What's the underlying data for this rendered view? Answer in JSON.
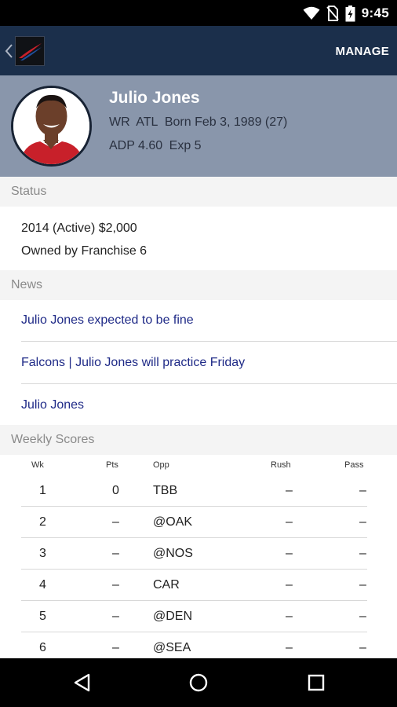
{
  "status_bar": {
    "time": "9:45"
  },
  "app_bar": {
    "manage_label": "MANAGE"
  },
  "player": {
    "name": "Julio Jones",
    "position": "WR",
    "team": "ATL",
    "born": "Born Feb 3, 1989 (27)",
    "adp": "ADP 4.60",
    "exp": "Exp 5"
  },
  "sections": {
    "status": "Status",
    "news": "News",
    "weekly_scores": "Weekly Scores"
  },
  "status_info": {
    "contract": "2014 (Active) $2,000",
    "owner": "Owned by Franchise 6"
  },
  "news": [
    "Julio Jones expected to be fine",
    "Falcons | Julio Jones will practice Friday",
    "Julio Jones"
  ],
  "scores": {
    "columns": {
      "wk": "Wk",
      "pts": "Pts",
      "opp": "Opp",
      "rush": "Rush",
      "pass": "Pass"
    },
    "rows": [
      {
        "wk": "1",
        "pts": "0",
        "opp": "TBB",
        "rush": "–",
        "pass": "–"
      },
      {
        "wk": "2",
        "pts": "–",
        "opp": "@OAK",
        "rush": "–",
        "pass": "–"
      },
      {
        "wk": "3",
        "pts": "–",
        "opp": "@NOS",
        "rush": "–",
        "pass": "–"
      },
      {
        "wk": "4",
        "pts": "–",
        "opp": "CAR",
        "rush": "–",
        "pass": "–"
      },
      {
        "wk": "5",
        "pts": "–",
        "opp": "@DEN",
        "rush": "–",
        "pass": "–"
      },
      {
        "wk": "6",
        "pts": "–",
        "opp": "@SEA",
        "rush": "–",
        "pass": "–"
      }
    ]
  }
}
